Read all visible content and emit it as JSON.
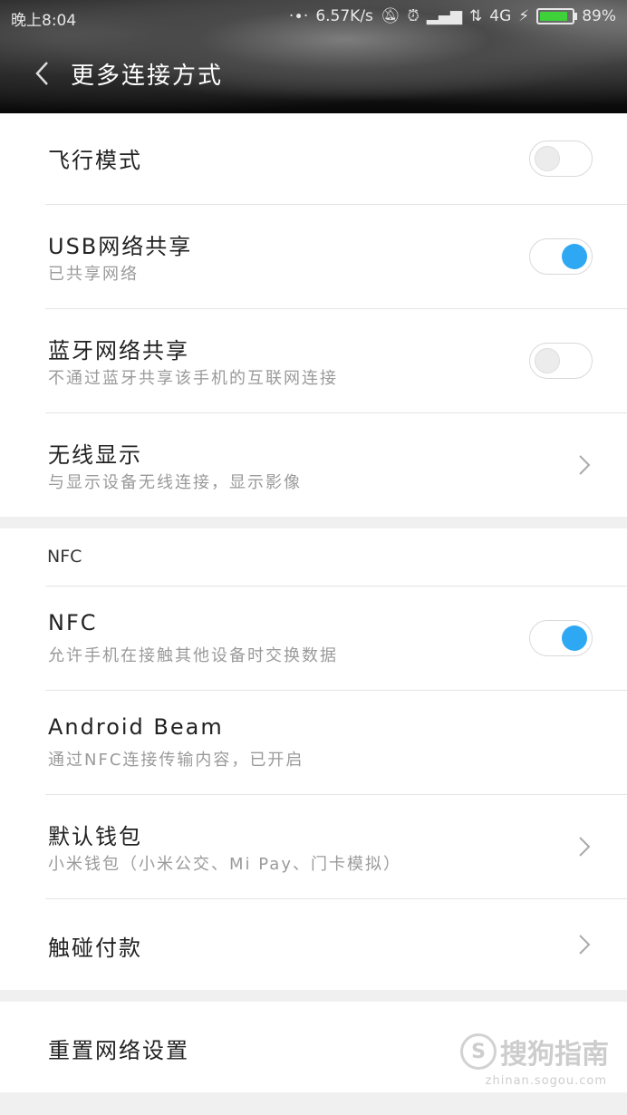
{
  "status_bar": {
    "time": "晚上8:04",
    "network_speed": "6.57K/s",
    "network_type": "4G",
    "battery_percent": "89%",
    "battery_level": 0.89
  },
  "header": {
    "title": "更多连接方式"
  },
  "section1": [
    {
      "title": "飞行模式",
      "subtitle": "",
      "control": "toggle",
      "state": "off"
    },
    {
      "title": "USB网络共享",
      "subtitle": "已共享网络",
      "control": "toggle",
      "state": "on"
    },
    {
      "title": "蓝牙网络共享",
      "subtitle": "不通过蓝牙共享该手机的互联网连接",
      "control": "toggle",
      "state": "off"
    },
    {
      "title": "无线显示",
      "subtitle": "与显示设备无线连接，显示影像",
      "control": "chevron"
    }
  ],
  "section2": {
    "header": "NFC",
    "rows": [
      {
        "title": "NFC",
        "subtitle": "允许手机在接触其他设备时交换数据",
        "control": "toggle",
        "state": "on"
      },
      {
        "title": "Android Beam",
        "subtitle": "通过NFC连接传输内容，已开启",
        "control": "none"
      },
      {
        "title": "默认钱包",
        "subtitle": "小米钱包（小米公交、Mi Pay、门卡模拟）",
        "control": "chevron"
      },
      {
        "title": "触碰付款",
        "subtitle": "",
        "control": "chevron"
      }
    ]
  },
  "section3": {
    "title": "重置网络设置"
  },
  "watermark": {
    "text": "搜狗指南",
    "url": "zhinan.sogou.com"
  },
  "colors": {
    "toggle_on": "#2ea8f3",
    "battery": "#3fd13a"
  }
}
